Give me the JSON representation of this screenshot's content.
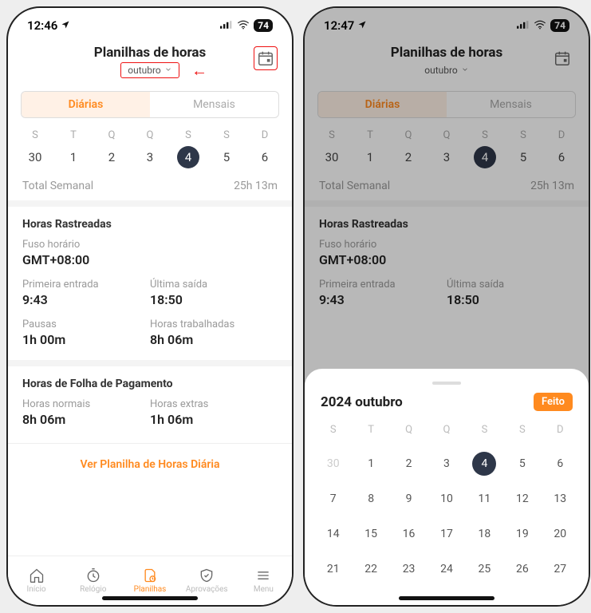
{
  "status": {
    "time_a": "12:46",
    "time_b": "12:47",
    "battery": "74"
  },
  "header": {
    "title": "Planilhas de horas",
    "month_label": "outubro"
  },
  "tabs": {
    "daily": "Diárias",
    "monthly": "Mensais"
  },
  "week": {
    "dows": [
      "S",
      "T",
      "Q",
      "Q",
      "S",
      "S",
      "D"
    ],
    "nums": [
      "30",
      "1",
      "2",
      "3",
      "4",
      "5",
      "6"
    ],
    "selected_index": 4,
    "total_label": "Total Semanal",
    "total_value": "25h 13m"
  },
  "tracked": {
    "title": "Horas Rastreadas",
    "tz_label": "Fuso horário",
    "tz_value": "GMT+08:00",
    "first_in_label": "Primeira entrada",
    "first_in_value": "9:43",
    "last_out_label": "Última saída",
    "last_out_value": "18:50",
    "breaks_label": "Pausas",
    "breaks_value": "1h 00m",
    "worked_label": "Horas trabalhadas",
    "worked_value": "8h 06m"
  },
  "payroll": {
    "title": "Horas de Folha de Pagamento",
    "regular_label": "Horas normais",
    "regular_value": "8h 06m",
    "extra_label": "Horas extras",
    "extra_value": "1h 06m"
  },
  "cta": "Ver Planilha de Horas Diária",
  "nav": {
    "home": "Início",
    "clock": "Relógio",
    "sheets": "Planilhas",
    "approvals": "Aprovações",
    "menu": "Menu"
  },
  "sheet": {
    "title": "2024 outubro",
    "done": "Feito",
    "dows": [
      "S",
      "T",
      "Q",
      "Q",
      "S",
      "S",
      "D"
    ],
    "prev": [
      "30"
    ],
    "days": [
      "1",
      "2",
      "3",
      "4",
      "5",
      "6",
      "7",
      "8",
      "9",
      "10",
      "11",
      "12",
      "13",
      "14",
      "15",
      "16",
      "17",
      "18",
      "19",
      "20",
      "21",
      "22",
      "23",
      "24",
      "25",
      "26",
      "27"
    ],
    "selected": "4"
  }
}
